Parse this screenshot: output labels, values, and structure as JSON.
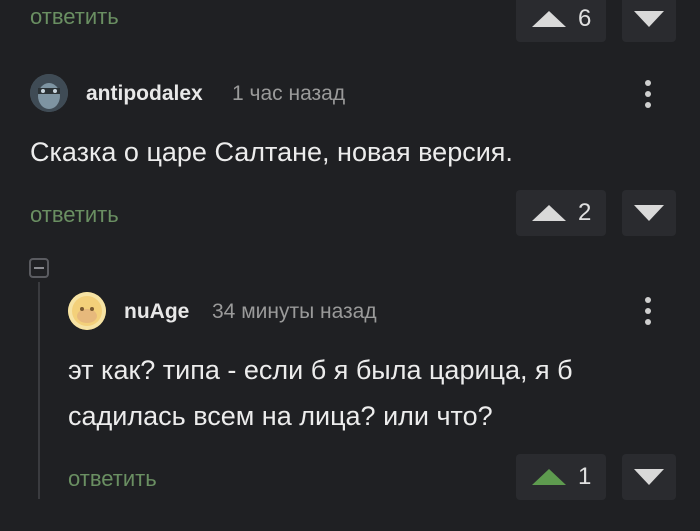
{
  "top_comment": {
    "reply_label": "ответить",
    "votes": "6"
  },
  "comment1": {
    "author": "antipodalex",
    "time": "1 час назад",
    "text": "Сказка о царе Салтане, новая версия.",
    "reply_label": "ответить",
    "votes": "2"
  },
  "comment2": {
    "author": "nuAge",
    "time": "34 минуты назад",
    "text_line1": "эт как? типа - если б я была царица, я б",
    "text_line2": "садилась всем на лица? или что?",
    "reply_label": "ответить",
    "votes": "1"
  },
  "colors": {
    "background": "#1f2023",
    "reply_link": "#6a8f62",
    "upvote_active": "#5e9b4f",
    "vote_icon": "#d9d9d9"
  }
}
